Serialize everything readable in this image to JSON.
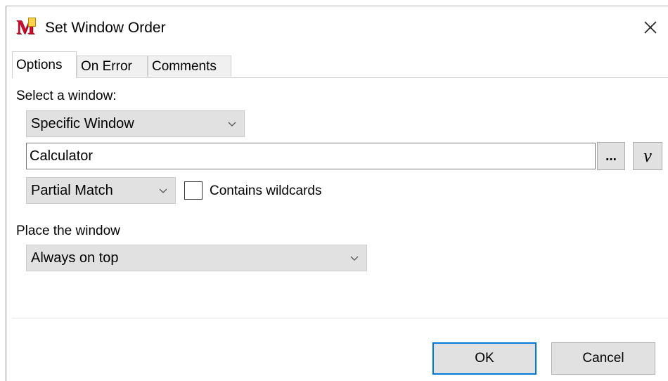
{
  "window": {
    "title": "Set Window Order",
    "app_icon_letter": "M"
  },
  "tabs": [
    {
      "label": "Options",
      "active": true
    },
    {
      "label": "On Error",
      "active": false
    },
    {
      "label": "Comments",
      "active": false
    }
  ],
  "options": {
    "select_window_label": "Select a window:",
    "window_mode_value": "Specific Window",
    "window_name_value": "Calculator",
    "browse_button_label": "...",
    "variable_button_label": "v",
    "match_mode_value": "Partial Match",
    "contains_wildcards_label": "Contains wildcards",
    "contains_wildcards_checked": false,
    "place_window_label": "Place the window",
    "place_window_value": "Always on top"
  },
  "footer": {
    "ok_label": "OK",
    "cancel_label": "Cancel"
  },
  "colors": {
    "accent": "#0078d7",
    "button_bg": "#e1e1e1",
    "icon_red": "#c8102e"
  }
}
